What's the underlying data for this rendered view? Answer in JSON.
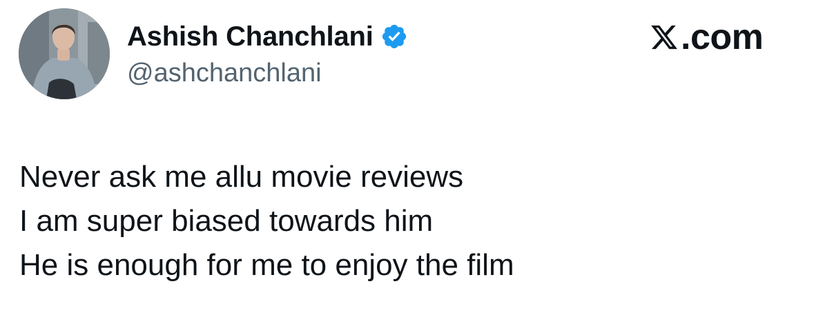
{
  "author": {
    "display_name": "Ashish Chanchlani",
    "handle": "@ashchanchlani",
    "verified": true,
    "avatar_icon": "profile-photo",
    "badge_icon": "verified-badge-icon",
    "badge_color": "#1d9bf0"
  },
  "brand": {
    "logo_icon": "x-logo-icon",
    "suffix": ".com"
  },
  "tweet": {
    "lines": [
      "Never ask me allu movie reviews",
      "I am super biased towards him",
      "He is enough for me to enjoy the film"
    ]
  },
  "colors": {
    "text": "#0f1419",
    "secondary_text": "#536471",
    "background": "#ffffff"
  }
}
